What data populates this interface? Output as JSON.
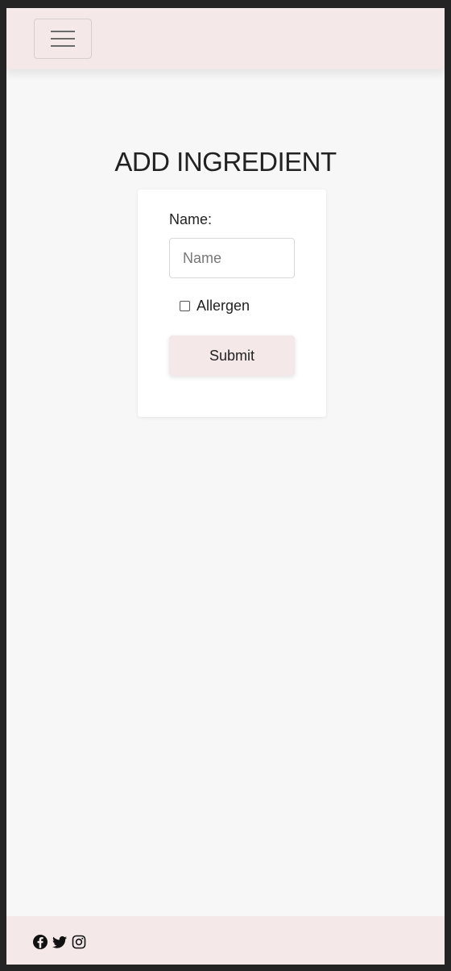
{
  "navbar": {
    "menu_icon": "hamburger-menu-icon",
    "background": "#f4e8e8"
  },
  "page": {
    "title": "ADD INGREDIENT",
    "background": "#f7f7f7"
  },
  "form": {
    "name_label": "Name:",
    "name_placeholder": "Name",
    "name_value": "",
    "allergen_label": "Allergen",
    "allergen_checked": false,
    "submit_label": "Submit"
  },
  "footer": {
    "icons": [
      "facebook-icon",
      "twitter-icon",
      "instagram-icon"
    ],
    "background": "#f4e8e8"
  }
}
